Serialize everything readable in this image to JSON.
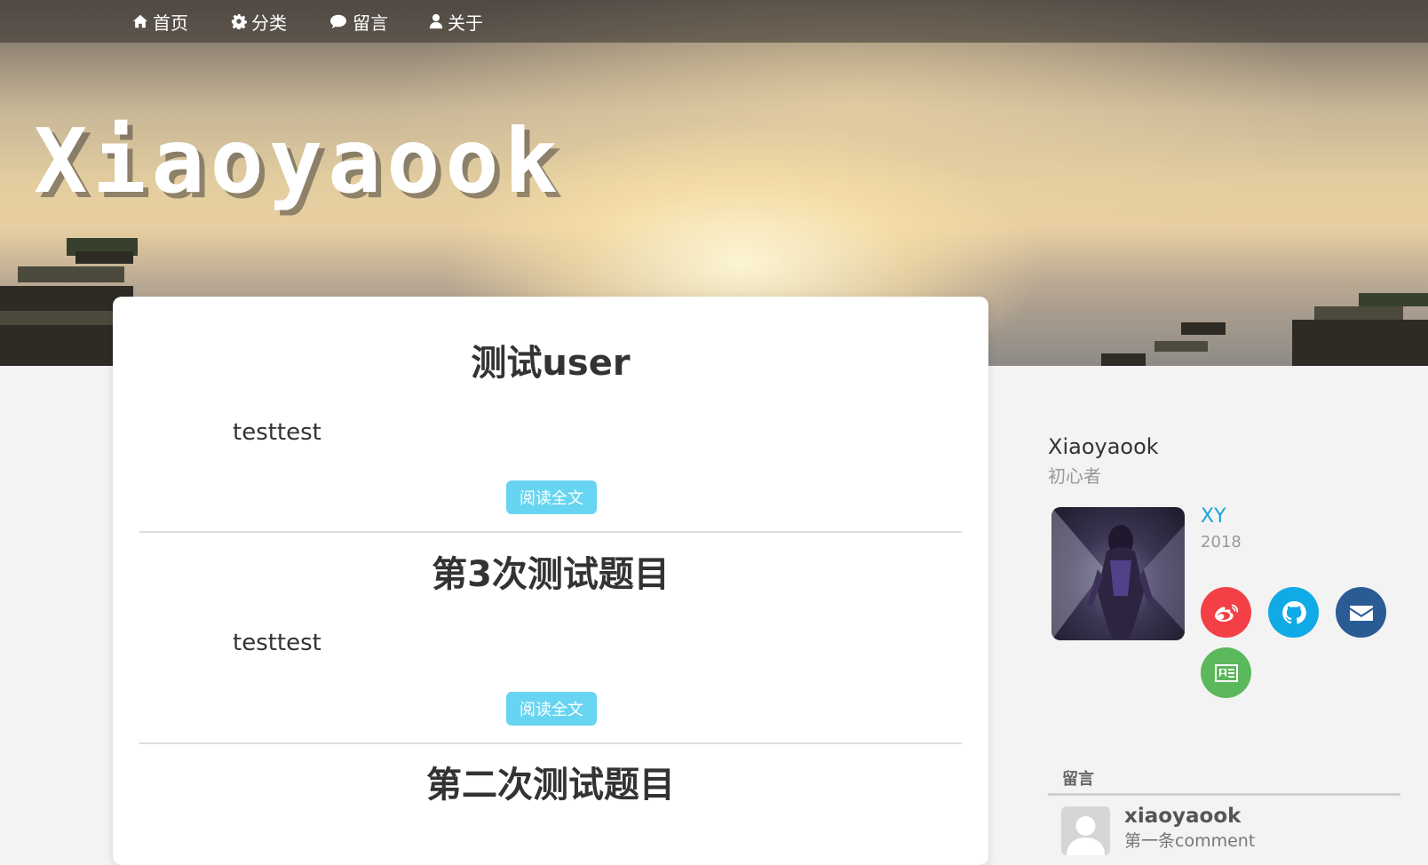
{
  "nav": {
    "items": [
      {
        "label": "首页",
        "icon": "home-icon"
      },
      {
        "label": "分类",
        "icon": "gear-icon"
      },
      {
        "label": "留言",
        "icon": "comment-icon"
      },
      {
        "label": "关于",
        "icon": "user-icon"
      }
    ]
  },
  "site": {
    "title": "Xiaoyaook"
  },
  "posts": [
    {
      "title": "测试user",
      "summary": "testtest",
      "read_label": "阅读全文"
    },
    {
      "title": "第3次测试题目",
      "summary": "testtest",
      "read_label": "阅读全文"
    },
    {
      "title": "第二次测试题目"
    }
  ],
  "profile": {
    "name": "Xiaoyaook",
    "motto": "初心者",
    "short_name": "XY",
    "year": "2018",
    "social": [
      {
        "icon": "weibo-icon",
        "color": "#f24046"
      },
      {
        "icon": "github-icon",
        "color": "#10aae6"
      },
      {
        "icon": "email-icon",
        "color": "#2a5b95"
      },
      {
        "icon": "contact-card-icon",
        "color": "#5cb85c"
      }
    ]
  },
  "comments": {
    "heading": "留言",
    "items": [
      {
        "user": "xiaoyaook",
        "text": "第一条comment"
      }
    ]
  }
}
